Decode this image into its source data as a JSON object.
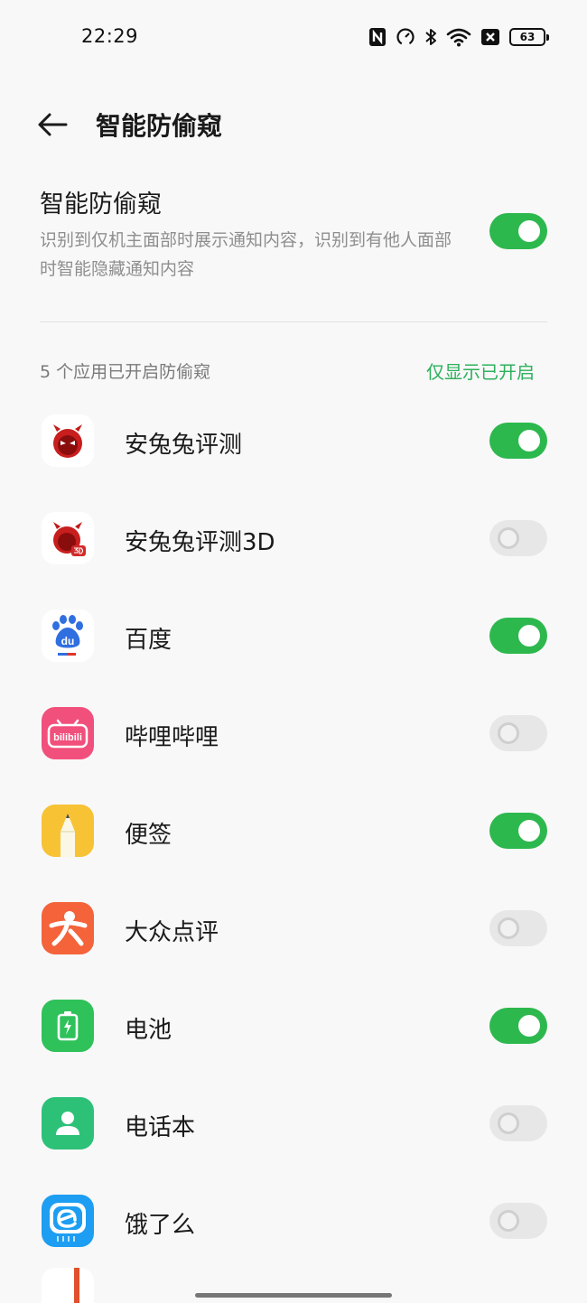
{
  "status_bar": {
    "time": "22:29",
    "battery_level": "63",
    "icons": [
      "nfc-icon",
      "data-saver-icon",
      "bluetooth-icon",
      "wifi-icon",
      "no-sim-icon",
      "battery-icon"
    ]
  },
  "header": {
    "title": "智能防偷窥",
    "back_icon": "arrow-left-icon"
  },
  "master_switch": {
    "title": "智能防偷窥",
    "description": "识别到仅机主面部时展示通知内容，识别到有他人面部时智能隐藏通知内容",
    "enabled": true
  },
  "section": {
    "count_label": "5 个应用已开启防偷窥",
    "filter_label": "仅显示已开启"
  },
  "apps": [
    {
      "name": "安兔兔评测",
      "icon": "antutu-icon",
      "enabled": true
    },
    {
      "name": "安兔兔评测3D",
      "icon": "antutu-3d-icon",
      "enabled": false
    },
    {
      "name": "百度",
      "icon": "baidu-icon",
      "enabled": true
    },
    {
      "name": "哔哩哔哩",
      "icon": "bilibili-icon",
      "enabled": false
    },
    {
      "name": "便签",
      "icon": "notes-icon",
      "enabled": true
    },
    {
      "name": "大众点评",
      "icon": "dianping-icon",
      "enabled": false
    },
    {
      "name": "电池",
      "icon": "battery-app-icon",
      "enabled": true
    },
    {
      "name": "电话本",
      "icon": "contacts-icon",
      "enabled": false
    },
    {
      "name": "饿了么",
      "icon": "eleme-icon",
      "enabled": false
    }
  ],
  "colors": {
    "accent": "#2fb05e",
    "toggle_on": "#2db84e",
    "toggle_off": "#e7e7e7",
    "background": "#f8f8f8"
  }
}
